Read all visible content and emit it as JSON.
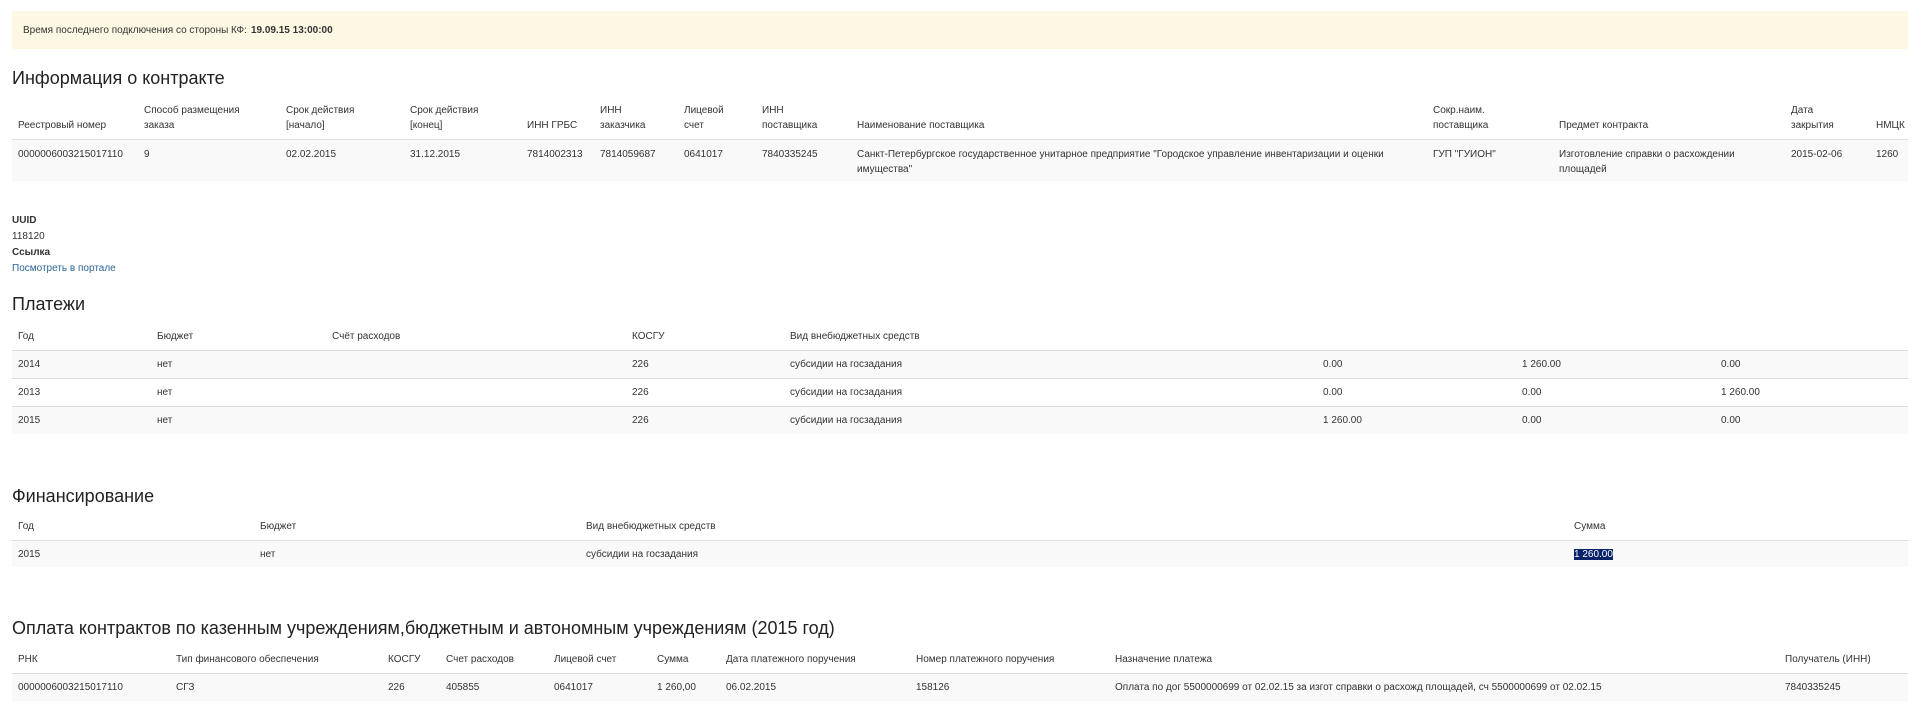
{
  "banner": {
    "label": "Время последнего подключения со стороны КФ:",
    "value": "19.09.15 13:00:00"
  },
  "contract": {
    "title": "Информация о контракте",
    "headers": [
      [
        "",
        "Реестровый номер"
      ],
      [
        "Способ размещения",
        "заказа"
      ],
      [
        "Срок действия",
        "[начало]"
      ],
      [
        "Срок действия",
        "[конец]"
      ],
      [
        "",
        "ИНН ГРБС"
      ],
      [
        "ИНН",
        "заказчика"
      ],
      [
        "Лицевой",
        "счет"
      ],
      [
        "ИНН",
        "поставщика"
      ],
      [
        "",
        "Наименование поставщика"
      ],
      [
        "Сокр.наим.",
        "поставщика"
      ],
      [
        "",
        "Предмет контракта"
      ],
      [
        "Дата",
        "закрытия"
      ],
      [
        "",
        "НМЦК"
      ]
    ],
    "row": [
      "0000006003215017110",
      "9",
      "02.02.2015",
      "31.12.2015",
      "7814002313",
      "7814059687",
      "0641017",
      "7840335245",
      "Санкт-Петербургское государственное унитарное предприятие \"Городское управление инвентаризации и оценки имущества\"",
      "ГУП \"ГУИОН\"",
      "Изготовление справки о расхождении площадей",
      "2015-02-06",
      "1260"
    ]
  },
  "meta": {
    "uuid_label": "UUID",
    "uuid_value": "118120",
    "link_label": "Ссылка",
    "link_text": "Посмотреть в портале"
  },
  "payments": {
    "title": "Платежи",
    "headers": [
      "Год",
      "Бюджет",
      "Счёт расходов",
      "КОСГУ",
      "Вид внебюджетных средств",
      "",
      "",
      ""
    ],
    "rows": [
      [
        "2014",
        "нет",
        "",
        "226",
        "субсидии на госзадания",
        "0.00",
        "1 260.00",
        "0.00"
      ],
      [
        "2013",
        "нет",
        "",
        "226",
        "субсидии на госзадания",
        "0.00",
        "0.00",
        "1 260.00"
      ],
      [
        "2015",
        "нет",
        "",
        "226",
        "субсидии на госзадания",
        "1 260.00",
        "0.00",
        "0.00"
      ]
    ]
  },
  "funding": {
    "title": "Финансирование",
    "headers": [
      "Год",
      "Бюджет",
      "Вид внебюджетных средств",
      "Сумма"
    ],
    "row": [
      "2015",
      "нет",
      "субсидии на госзадания",
      "1 260.00"
    ]
  },
  "pay2": {
    "title": "Оплата контрактов по казенным учреждениям,бюджетным и автономным учреждениям (2015 год)",
    "headers": [
      "РНК",
      "Тип финансового обеспечения",
      "КОСГУ",
      "Счет расходов",
      "Лицевой счет",
      "Сумма",
      "Дата платежного поручения",
      "Номер платежного поручения",
      "Назначение платежа",
      "Получатель (ИНН)"
    ],
    "row": [
      "0000006003215017110",
      "СГЗ",
      "226",
      "405855",
      "0641017",
      "1 260,00",
      "06.02.2015",
      "158126",
      "Оплата по дог 5500000699 от 02.02.15 за изгот справки о расхожд площадей, сч 5500000699 от 02.02.15",
      "7840335245"
    ]
  }
}
